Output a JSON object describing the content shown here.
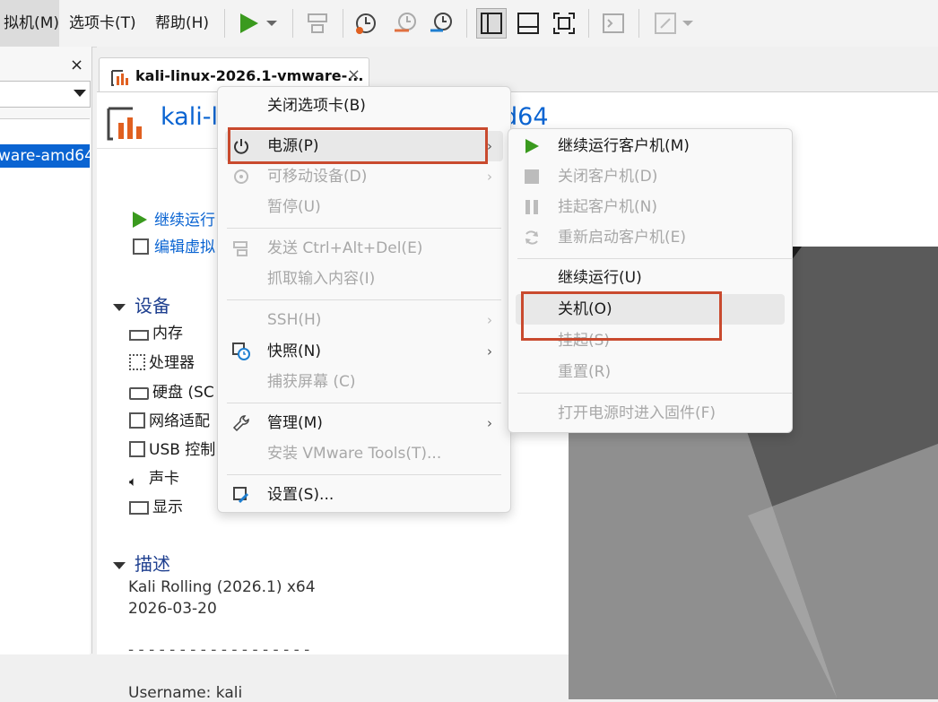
{
  "menubar": {
    "vm_label": "拟机(M)",
    "tabs_label": "选项卡(T)",
    "help_label": "帮助(H)"
  },
  "library": {
    "close_glyph": "×",
    "selected_item": "ware-amd64"
  },
  "tab": {
    "label": "kali-linux-2026.1-vmware-...",
    "close_glyph": "×"
  },
  "vm": {
    "title": "kali-l",
    "title_tail": "d64",
    "actions": {
      "power_on": "继续运行",
      "edit": "编辑虚拟"
    },
    "devices_header": "设备",
    "devices": [
      "内存",
      "处理器",
      "硬盘 (SC",
      "网络适配",
      "USB 控制",
      "声卡",
      "显示"
    ],
    "description_header": "描述",
    "description": {
      "line1": "Kali Rolling (2026.1) x64",
      "line2": "2026-03-20",
      "line3": "- - - - - - - - - - - - - - - - - -",
      "line4": "Username: kali"
    }
  },
  "context_menu": {
    "close_tab": "关闭选项卡(B)",
    "power": "电源(P)",
    "removable": "可移动设备(D)",
    "pause": "暂停(U)",
    "send_cad": "发送 Ctrl+Alt+Del(E)",
    "grab_input": "抓取输入内容(I)",
    "ssh": "SSH(H)",
    "snapshot": "快照(N)",
    "capture": "捕获屏幕 (C)",
    "manage": "管理(M)",
    "install_tools": "安装 VMware Tools(T)...",
    "settings": "设置(S)...",
    "arrow": "›"
  },
  "power_menu": {
    "resume_guest": "继续运行客户机(M)",
    "shutdown_guest": "关闭客户机(D)",
    "suspend_guest": "挂起客户机(N)",
    "restart_guest": "重新启动客户机(E)",
    "resume": "继续运行(U)",
    "power_off": "关机(O)",
    "suspend": "挂起(S)",
    "reset": "重置(R)",
    "firmware": "打开电源时进入固件(F)"
  },
  "colors": {
    "accent": "#0a64d2",
    "highlight": "#c94a2e",
    "play_green": "#3a9a1e",
    "disabled": "#a8a8a8"
  }
}
